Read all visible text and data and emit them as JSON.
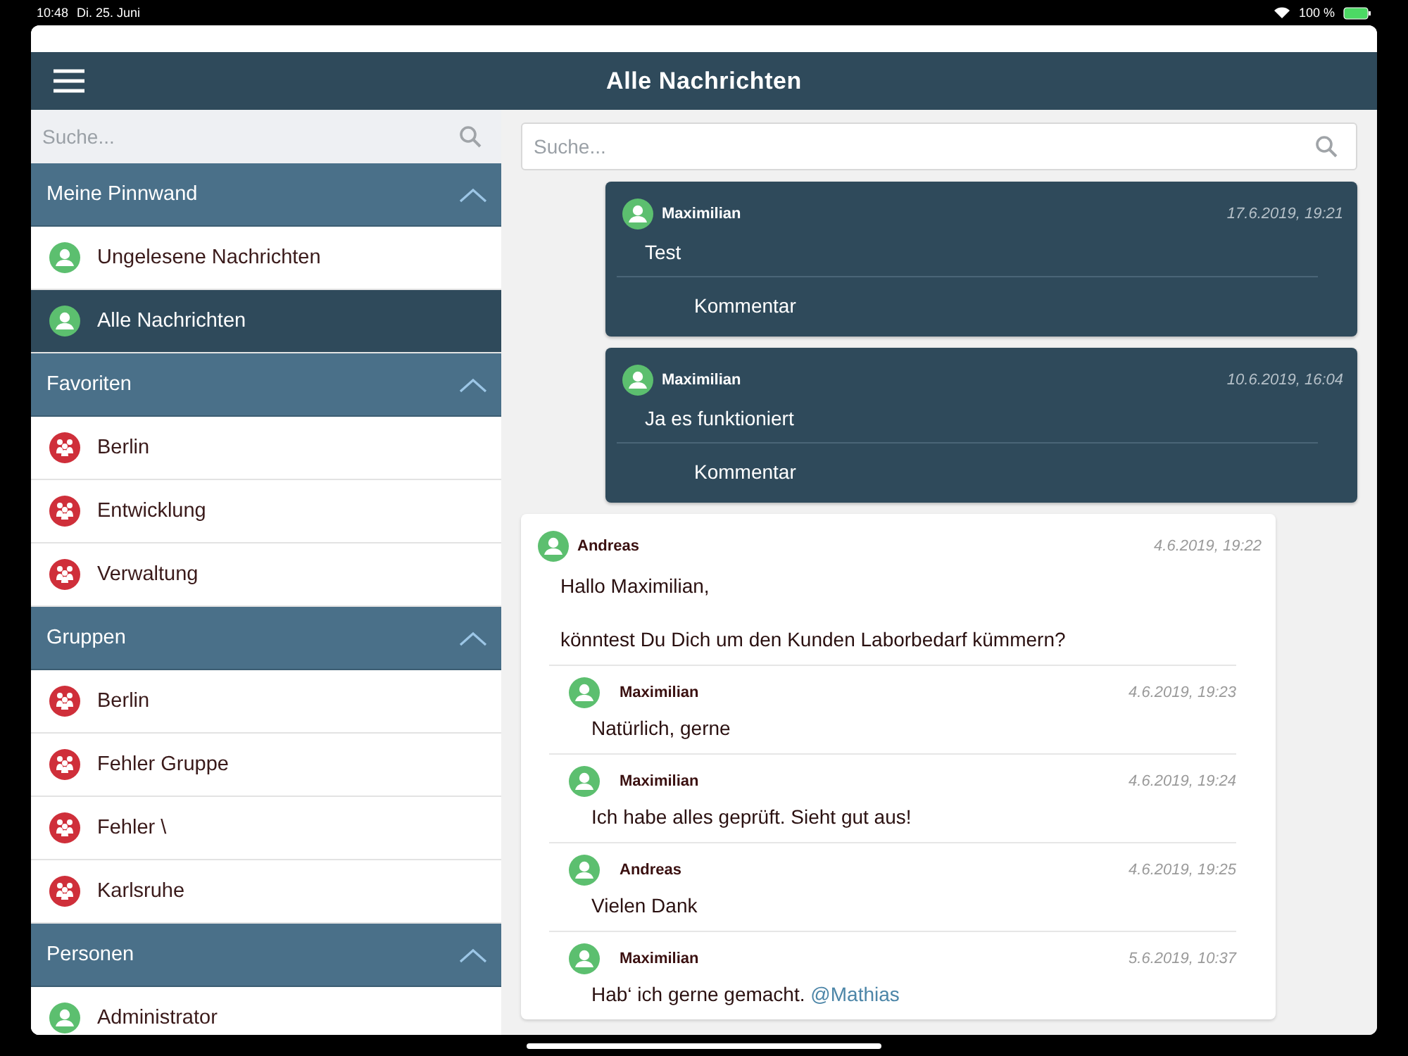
{
  "status_bar": {
    "time": "10:48",
    "date": "Di. 25. Juni",
    "battery": "100 %"
  },
  "header": {
    "title": "Alle Nachrichten"
  },
  "sidebar": {
    "search": {
      "placeholder": "Suche..."
    },
    "sections": [
      {
        "title": "Meine Pinnwand",
        "expanded": true,
        "items": [
          {
            "label": "Ungelesene Nachrichten",
            "kind": "person",
            "selected": false
          },
          {
            "label": "Alle Nachrichten",
            "kind": "person",
            "selected": true
          }
        ]
      },
      {
        "title": "Favoriten",
        "expanded": true,
        "items": [
          {
            "label": "Berlin",
            "kind": "group",
            "selected": false
          },
          {
            "label": "Entwicklung",
            "kind": "group",
            "selected": false
          },
          {
            "label": "Verwaltung",
            "kind": "group",
            "selected": false
          }
        ]
      },
      {
        "title": "Gruppen",
        "expanded": true,
        "items": [
          {
            "label": "Berlin",
            "kind": "group",
            "selected": false
          },
          {
            "label": "Fehler Gruppe",
            "kind": "group",
            "selected": false
          },
          {
            "label": "Fehler \\",
            "kind": "group",
            "selected": false
          },
          {
            "label": "Karlsruhe",
            "kind": "group",
            "selected": false
          }
        ]
      },
      {
        "title": "Personen",
        "expanded": true,
        "items": [
          {
            "label": "Administrator",
            "kind": "person",
            "selected": false
          }
        ]
      }
    ]
  },
  "feed": {
    "search": {
      "placeholder": "Suche..."
    },
    "posts": [
      {
        "kind": "own",
        "author": "Maximilian",
        "time": "17.6.2019, 19:21",
        "text": [
          "Test"
        ],
        "comment_action": "Kommentar"
      },
      {
        "kind": "own",
        "author": "Maximilian",
        "time": "10.6.2019, 16:04",
        "text": [
          "Ja es funktioniert"
        ],
        "comment_action": "Kommentar"
      },
      {
        "kind": "other",
        "author": "Andreas",
        "time": "4.6.2019, 19:22",
        "text": [
          "Hallo Maximilian,",
          "könntest Du Dich um den Kunden Laborbedarf kümmern?"
        ],
        "replies": [
          {
            "author": "Maximilian",
            "time": "4.6.2019, 19:23",
            "text": "Natürlich, gerne"
          },
          {
            "author": "Maximilian",
            "time": "4.6.2019, 19:24",
            "text": "Ich habe alles geprüft. Sieht gut aus!"
          },
          {
            "author": "Andreas",
            "time": "4.6.2019, 19:25",
            "text": "Vielen Dank"
          },
          {
            "author": "Maximilian",
            "time": "5.6.2019, 10:37",
            "text": "Hab‘ ich gerne gemacht.",
            "mention": "@Mathias"
          }
        ]
      }
    ]
  }
}
